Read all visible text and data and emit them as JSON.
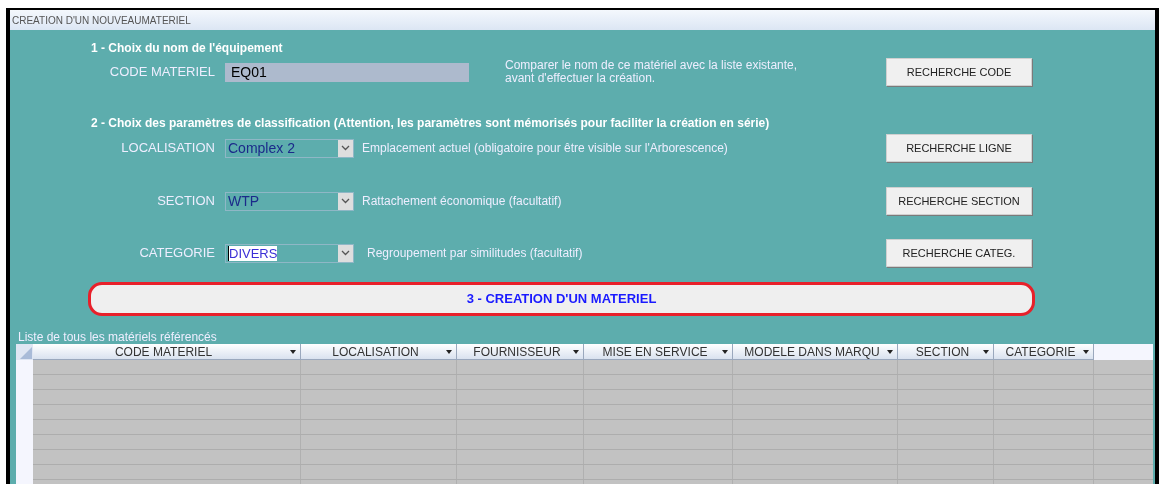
{
  "window": {
    "title": "CREATION D'UN NOUVEAUMATERIEL"
  },
  "section1": {
    "heading": "1 - Choix du nom de l'équipement",
    "label": "CODE MATERIEL",
    "value": "EQ01",
    "description": "Comparer le nom de ce matériel avec la liste existante, avant d'effectuer la création.",
    "button": "RECHERCHE CODE"
  },
  "section2": {
    "heading": "2 - Choix des paramètres de classification (Attention, les paramètres sont  mémorisés pour faciliter la création en série)",
    "fields": [
      {
        "label": "LOCALISATION",
        "value": "Complex 2",
        "focused": false,
        "description": "Emplacement actuel (obligatoire pour être visible sur l'Arborescence)",
        "button": "RECHERCHE LIGNE"
      },
      {
        "label": "SECTION",
        "value": "WTP",
        "focused": false,
        "description": "Rattachement économique (facultatif)",
        "button": "RECHERCHE SECTION"
      },
      {
        "label": "CATEGORIE",
        "value": "DIVERS",
        "focused": true,
        "description": "Regroupement par similitudes (facultatif)",
        "button": "RECHERCHE CATEG."
      }
    ]
  },
  "create_button": "3 - CREATION D'UN MATERIEL",
  "table": {
    "caption": "Liste de tous les matériels référencés",
    "columns": [
      {
        "label": "CODE MATERIEL"
      },
      {
        "label": "LOCALISATION"
      },
      {
        "label": "FOURNISSEUR"
      },
      {
        "label": "MISE EN SERVICE"
      },
      {
        "label": "MODELE DANS MARQU"
      },
      {
        "label": "SECTION"
      },
      {
        "label": "CATEGORIE"
      }
    ]
  }
}
